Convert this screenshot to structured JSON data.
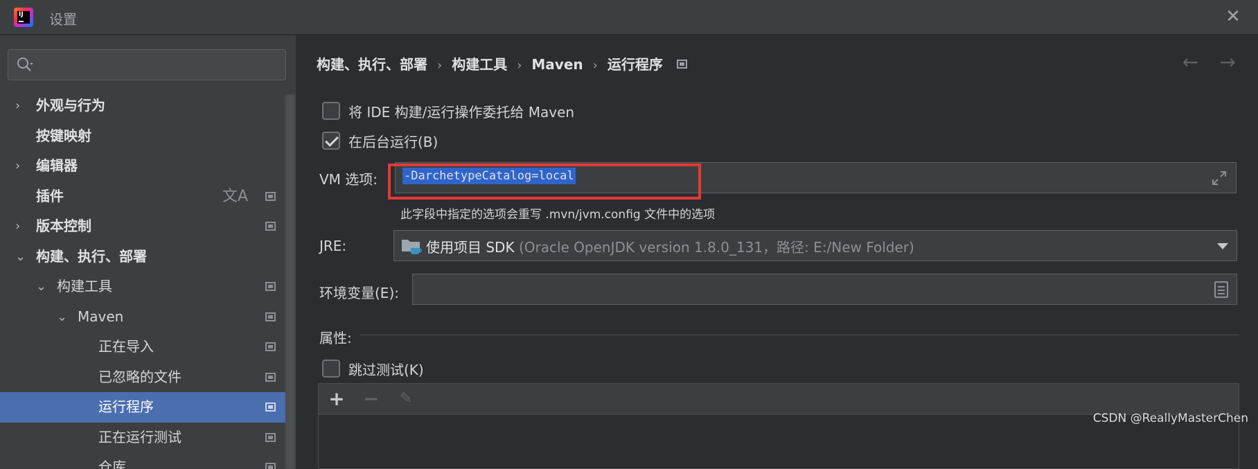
{
  "window": {
    "title": "设置",
    "close_glyph": "✕",
    "logo_text": "IJ"
  },
  "search": {
    "placeholder": "",
    "value": ""
  },
  "sidebar": {
    "items": [
      {
        "label": "外观与行为",
        "arrow": "›"
      },
      {
        "label": "按键映射",
        "arrow": ""
      },
      {
        "label": "编辑器",
        "arrow": "›"
      },
      {
        "label": "插件",
        "arrow": "",
        "trans": "文A"
      },
      {
        "label": "版本控制",
        "arrow": "›"
      },
      {
        "label": "构建、执行、部署",
        "arrow": "⌄"
      },
      {
        "label": "构建工具",
        "arrow": "⌄"
      },
      {
        "label": "Maven",
        "arrow": "⌄"
      },
      {
        "label": "正在导入"
      },
      {
        "label": "已忽略的文件"
      },
      {
        "label": "运行程序"
      },
      {
        "label": "正在运行测试"
      },
      {
        "label": "仓库"
      }
    ]
  },
  "breadcrumb": {
    "items": [
      "构建、执行、部署",
      "构建工具",
      "Maven",
      "运行程序"
    ],
    "sep": "›"
  },
  "nav": {
    "back": "←",
    "forward": "→"
  },
  "delegate": {
    "label": "将 IDE 构建/运行操作委托给 Maven",
    "checked": false
  },
  "background": {
    "label": "在后台运行(B)",
    "checked": true
  },
  "vm": {
    "label": "VM 选项:",
    "value": "-DarchetypeCatalog=local",
    "hint": "此字段中指定的选项会重写 .mvn/jvm.config 文件中的选项"
  },
  "jre": {
    "label": "JRE:",
    "value": "使用项目 SDK",
    "detail": "(Oracle OpenJDK version 1.8.0_131，路径: E:/New Folder)"
  },
  "env": {
    "label": "环境变量(E):",
    "value": ""
  },
  "properties": {
    "label": "属性:"
  },
  "skip_tests": {
    "label": "跳过测试(K)",
    "checked": false
  },
  "table_toolbar": {
    "add": "+",
    "remove": "−",
    "edit": "✎"
  },
  "watermark": "CSDN @ReallyMasterChen",
  "colors": {
    "selection": "#4b6eaf",
    "highlight": "#e53935",
    "text_selection": "#2f65ca"
  }
}
